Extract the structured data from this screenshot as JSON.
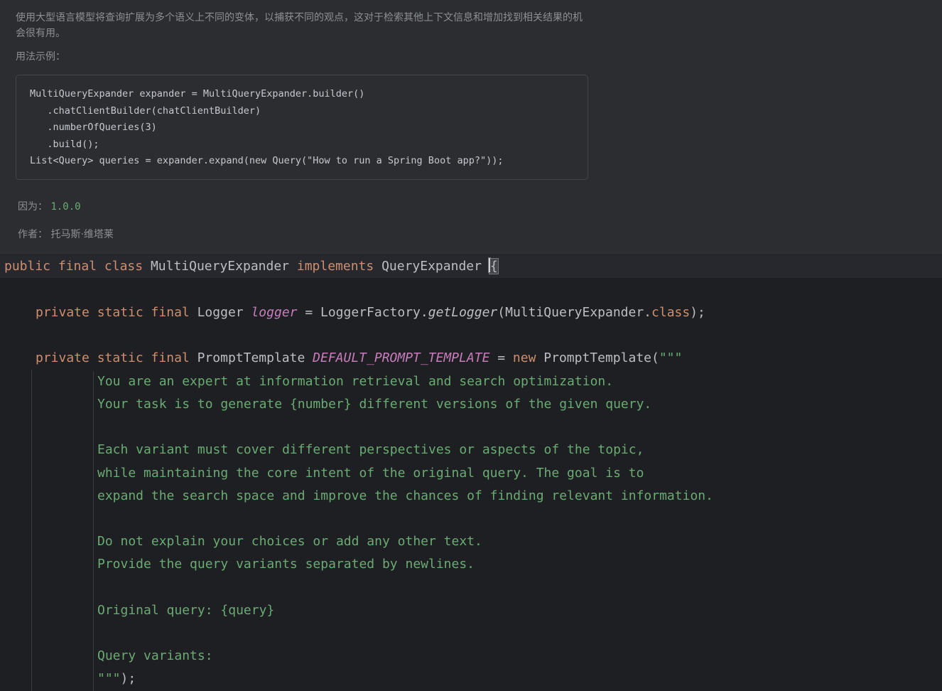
{
  "doc": {
    "description": "使用大型语言模型将查询扩展为多个语义上不同的变体，以捕获不同的观点，这对于检索其他上下文信息和增加找到相关结果的机会很有用。",
    "usage_label": "用法示例：",
    "example_lines": [
      "MultiQueryExpander expander = MultiQueryExpander.builder()",
      "   .chatClientBuilder(chatClientBuilder)",
      "   .numberOfQueries(3)",
      "   .build();",
      "List<Query> queries = expander.expand(new Query(\"How to run a Spring Boot app?\"));"
    ],
    "since_label": "因为：",
    "since_value": "1.0.0",
    "author_label": "作者：",
    "author_value": "托马斯·维塔莱"
  },
  "code": {
    "class_kw1": "public",
    "class_kw2": "final",
    "class_kw3": "class",
    "class_name": "MultiQueryExpander",
    "implements_kw": "implements",
    "interface_name": "QueryExpander",
    "open_brace": "{",
    "logger_mods": "private static final",
    "logger_type": "Logger",
    "logger_field": "logger",
    "logger_eq": " = LoggerFactory.",
    "logger_method": "getLogger",
    "logger_arg": "(MultiQueryExpander.",
    "logger_class_kw": "class",
    "logger_end": ");",
    "tmpl_mods": "private static final",
    "tmpl_type": "PromptTemplate",
    "tmpl_field": "DEFAULT_PROMPT_TEMPLATE",
    "tmpl_eq": " = ",
    "tmpl_new": "new",
    "tmpl_ctor": " PromptTemplate(",
    "tmpl_open": "\"\"\"",
    "text_block": [
      "You are an expert at information retrieval and search optimization.",
      "Your task is to generate {number} different versions of the given query.",
      "",
      "Each variant must cover different perspectives or aspects of the topic,",
      "while maintaining the core intent of the original query. The goal is to",
      "expand the search space and improve the chances of finding relevant information.",
      "",
      "Do not explain your choices or add any other text.",
      "Provide the query variants separated by newlines.",
      "",
      "Original query: {query}",
      "",
      "Query variants:"
    ],
    "tmpl_close": "\"\"\"",
    "tmpl_close_end": ");"
  }
}
